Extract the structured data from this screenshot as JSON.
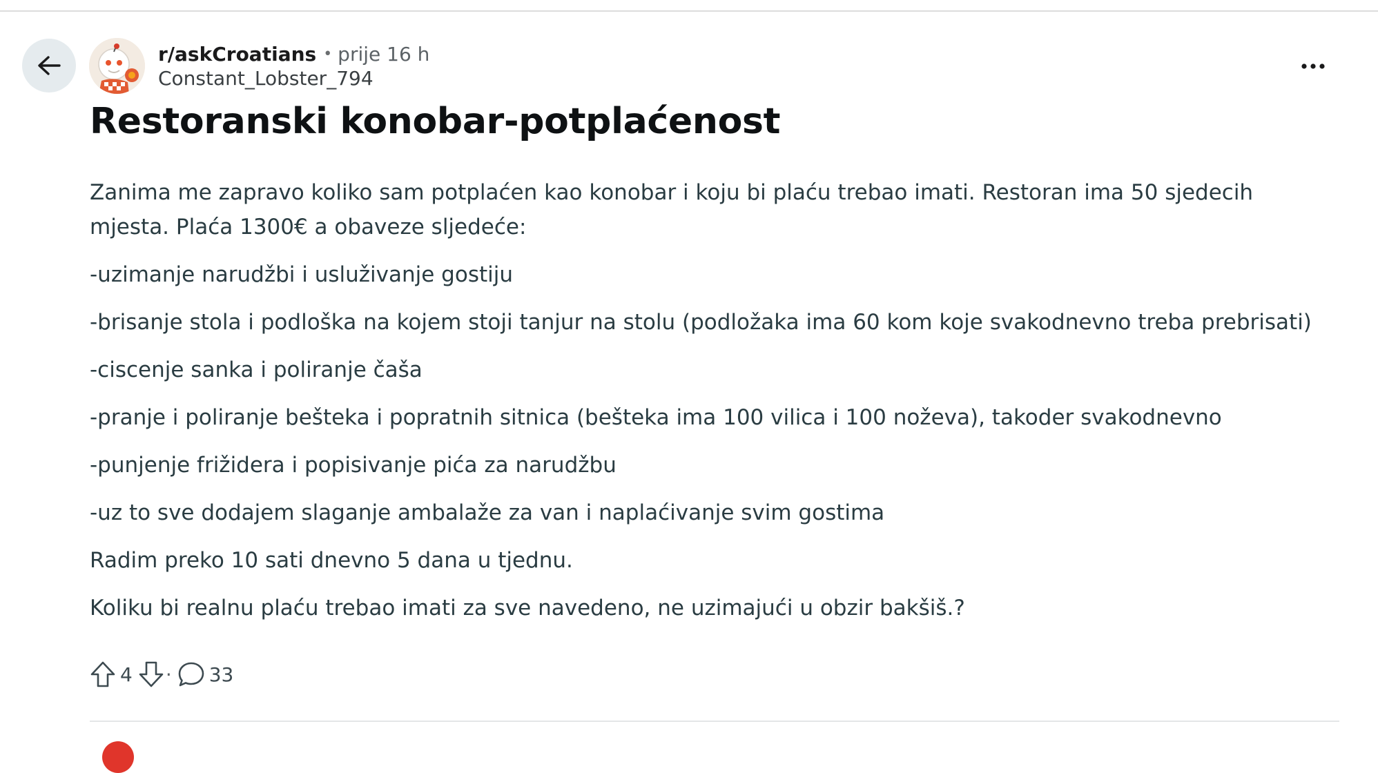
{
  "post": {
    "subreddit": "r/askCroatians",
    "separator": "•",
    "time": "prije 16 h",
    "author": "Constant_Lobster_794",
    "title": "Restoranski konobar-potplaćenost",
    "paragraphs": [
      "Zanima me zapravo koliko sam potplaćen kao konobar i koju bi plaću trebao imati. Restoran ima 50 sjedecih mjesta. Plaća 1300€ a obaveze sljedeće:",
      "-uzimanje narudžbi i usluživanje gostiju",
      "-brisanje stola i podloška na kojem stoji tanjur na stolu (podložaka ima 60 kom koje svakodnevno treba prebrisati)",
      "-ciscenje sanka i poliranje čaša",
      "-pranje i poliranje bešteka i popratnih sitnica (bešteka ima 100 vilica i 100 noževa), takoder svakodnevno",
      "-punjenje frižidera i popisivanje pića za narudžbu",
      "-uz to sve dodajem slaganje ambalaže za van i naplaćivanje svim gostima",
      "Radim preko 10 sati dnevno 5 dana u tjednu.",
      "Koliku bi realnu plaću trebao imati za sve navedeno, ne uzimajući u obzir bakšiš.?"
    ],
    "votes": "4",
    "action_separator": "·",
    "comments": "33"
  },
  "icons": {
    "back": "arrow-left-icon",
    "more": "more-horizontal-icon",
    "upvote": "upvote-arrow-icon",
    "downvote": "downvote-arrow-icon",
    "comment": "comment-bubble-icon"
  },
  "colors": {
    "back_button_bg": "#e5ebee",
    "text_primary": "#0e1113",
    "text_body": "#2a3c42",
    "text_meta": "#5c6266"
  }
}
